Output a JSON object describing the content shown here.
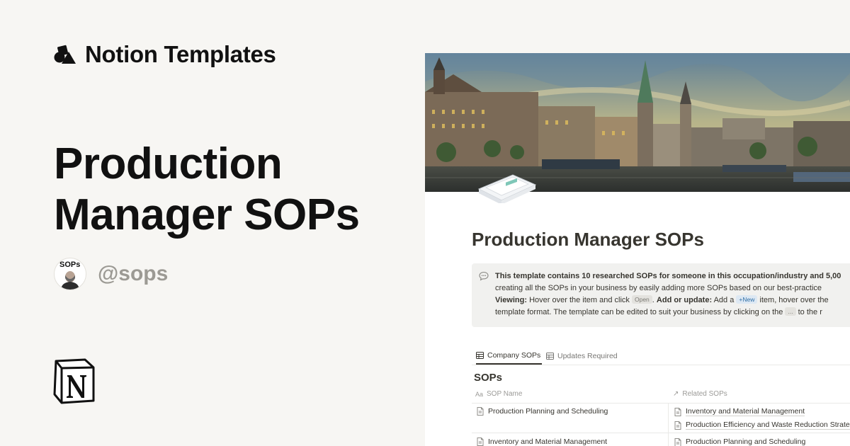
{
  "brand": {
    "name": "Notion Templates"
  },
  "headline": {
    "line1": "Production",
    "line2": "Manager SOPs"
  },
  "author": {
    "avatar_tag": "SOPs",
    "handle": "@sops"
  },
  "preview": {
    "page_title": "Production Manager SOPs",
    "callout": {
      "line1": "This template contains 10 researched SOPs for someone in this occupation/industry and 5,00",
      "line2": "creating all the SOPs in your business by easily adding more SOPs based on our best-practice",
      "line3": {
        "viewing_label": "Viewing:",
        "text_a": " Hover over the item and click ",
        "open_pill": "Open",
        "text_b": ". ",
        "add_label": "Add or update:",
        "text_c": " Add a ",
        "new_pill": "+New",
        "text_d": " item, hover over the"
      },
      "line4": {
        "text_a": "template format. The template can be edited to suit your business by clicking on the ",
        "dots_pill": "...",
        "text_b": " to the r"
      }
    },
    "tabs": [
      {
        "label": "Company SOPs",
        "active": true
      },
      {
        "label": "Updates Required",
        "active": false
      }
    ],
    "database_title": "SOPs",
    "columns": [
      {
        "icon": "Aa",
        "label": "SOP Name"
      },
      {
        "icon": "↗",
        "label": "Related SOPs"
      }
    ],
    "rows": [
      {
        "name": "Production Planning and Scheduling",
        "related": [
          "Inventory and Material Management",
          "Production Efficiency and Waste Reduction Strate"
        ]
      },
      {
        "name": "Inventory and Material Management",
        "related": [
          "Production Planning and Scheduling"
        ]
      }
    ]
  },
  "colors": {
    "background": "#f7f6f3",
    "text": "#111111",
    "muted": "#9c9a94",
    "notion_text": "#37352f"
  }
}
